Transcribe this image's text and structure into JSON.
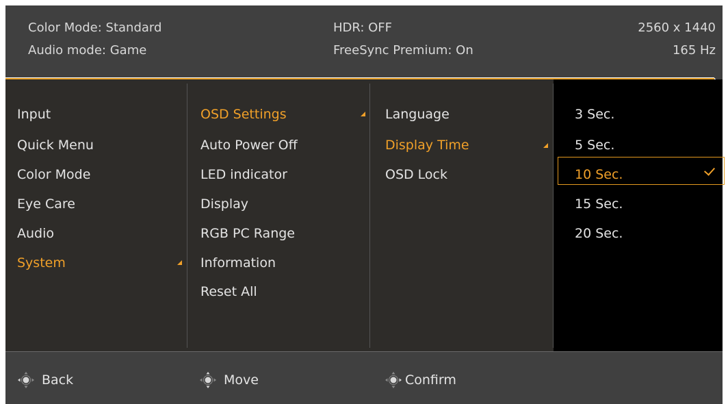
{
  "header": {
    "color_mode": "Color Mode: Standard",
    "audio_mode": "Audio mode: Game",
    "hdr": "HDR: OFF",
    "freesync": "FreeSync Premium: On",
    "resolution": "2560 x 1440",
    "refresh": "165 Hz"
  },
  "menu": {
    "level1": [
      "Input",
      "Quick Menu",
      "Color Mode",
      "Eye Care",
      "Audio",
      "System"
    ],
    "level1_active": "System",
    "level2": [
      "OSD Settings",
      "Auto Power Off",
      "LED indicator",
      "Display",
      "RGB PC Range",
      "Information",
      "Reset All"
    ],
    "level2_active": "OSD Settings",
    "level3": [
      "Language",
      "Display Time",
      "OSD Lock"
    ],
    "level3_active": "Display Time",
    "level4": [
      "3 Sec.",
      "5 Sec.",
      "10 Sec.",
      "15 Sec.",
      "20 Sec."
    ],
    "level4_selected": "10 Sec."
  },
  "footer": {
    "back": "Back",
    "move": "Move",
    "confirm": "Confirm"
  },
  "colors": {
    "accent": "#f0a029",
    "header_bg": "#404040",
    "body_bg": "#2e2c29",
    "options_bg": "#000000"
  },
  "icons": {
    "footer_icon": "joystick-icon",
    "submenu_indicator": "corner-triangle-icon",
    "selected_indicator": "checkmark-icon"
  }
}
